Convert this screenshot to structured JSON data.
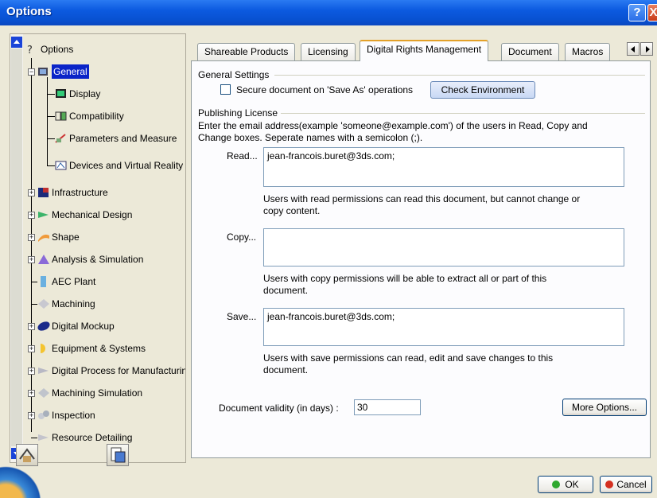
{
  "window": {
    "title": "Options",
    "help_label": "?",
    "close_label": "X"
  },
  "tree": {
    "root": "Options",
    "items": [
      {
        "label": "General",
        "icon": "general-icon",
        "selected": true
      },
      {
        "label": "Display",
        "icon": "display-icon"
      },
      {
        "label": "Compatibility",
        "icon": "compatibility-icon"
      },
      {
        "label": "Parameters and Measure",
        "icon": "parameters-icon"
      },
      {
        "label": "Devices and Virtual Reality",
        "icon": "devices-icon"
      },
      {
        "label": "Infrastructure",
        "icon": "infrastructure-icon"
      },
      {
        "label": "Mechanical Design",
        "icon": "mechanical-design-icon"
      },
      {
        "label": "Shape",
        "icon": "shape-icon"
      },
      {
        "label": "Analysis & Simulation",
        "icon": "analysis-icon"
      },
      {
        "label": "AEC Plant",
        "icon": "aec-plant-icon"
      },
      {
        "label": "Machining",
        "icon": "machining-icon"
      },
      {
        "label": "Digital Mockup",
        "icon": "digital-mockup-icon"
      },
      {
        "label": "Equipment & Systems",
        "icon": "equipment-icon"
      },
      {
        "label": "Digital Process for Manufacturing",
        "icon": "digital-process-icon"
      },
      {
        "label": "Machining Simulation",
        "icon": "machining-simulation-icon"
      },
      {
        "label": "Inspection",
        "icon": "inspection-icon"
      },
      {
        "label": "Resource Detailing",
        "icon": "resource-detailing-icon"
      }
    ]
  },
  "tabs": [
    {
      "label": "Shareable Products"
    },
    {
      "label": "Licensing"
    },
    {
      "label": "Digital Rights Management",
      "active": true
    },
    {
      "label": "Document"
    },
    {
      "label": "Macros"
    }
  ],
  "general_settings": {
    "header": "General Settings",
    "secure_label": "Secure document on 'Save As' operations",
    "secure_checked": false,
    "check_env_label": "Check Environment"
  },
  "publishing": {
    "header": "Publishing License",
    "instructions": "Enter the email address(example 'someone@example.com') of the users in Read, Copy and Change boxes. Seperate names with a semicolon (;).",
    "read_label": "Read...",
    "read_value": "jean-francois.buret@3ds.com;",
    "read_help": "Users with read permissions can read this document, but cannot change or copy  content.",
    "copy_label": "Copy...",
    "copy_value": "",
    "copy_help": "Users with copy permissions will be able to extract all or part of this document.",
    "save_label": "Save...",
    "save_value": "jean-francois.buret@3ds.com;",
    "save_help": "Users with save permissions can read, edit and save changes to this document."
  },
  "validity": {
    "label": "Document validity (in days) :",
    "value": "30"
  },
  "more_options_label": "More Options...",
  "ok_label": "OK",
  "cancel_label": "Cancel",
  "colors": {
    "ok_dot": "#2fa82f",
    "cancel_dot": "#d43020",
    "selection": "#0a24c8"
  }
}
